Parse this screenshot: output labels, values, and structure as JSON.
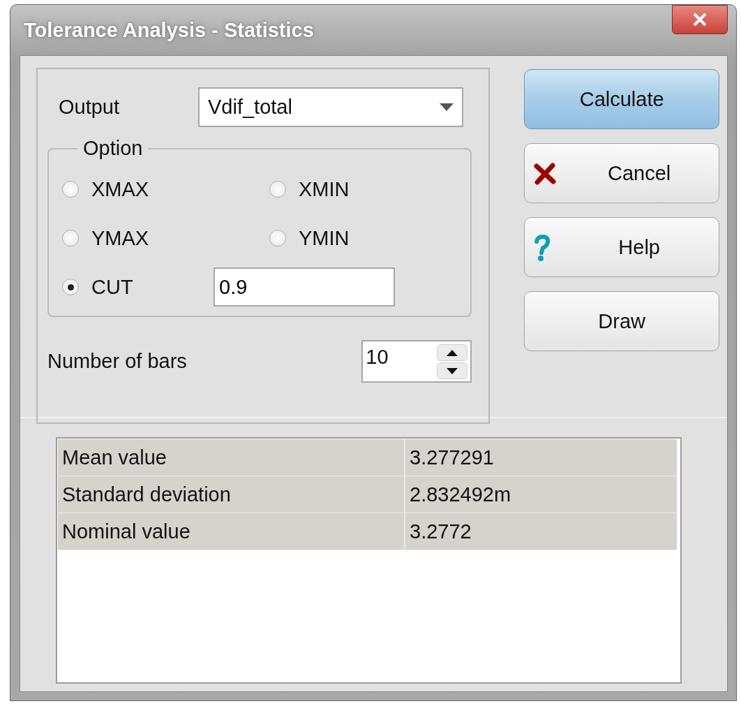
{
  "window": {
    "title": "Tolerance Analysis - Statistics"
  },
  "output": {
    "label": "Output",
    "value": "Vdif_total"
  },
  "option_group": {
    "title": "Option",
    "options": [
      {
        "label": "XMAX",
        "selected": false
      },
      {
        "label": "XMIN",
        "selected": false
      },
      {
        "label": "YMAX",
        "selected": false
      },
      {
        "label": "YMIN",
        "selected": false
      },
      {
        "label": "CUT",
        "selected": true,
        "value": "0.9"
      }
    ]
  },
  "bars": {
    "label": "Number of bars",
    "value": "10"
  },
  "buttons": [
    {
      "label": "Calculate",
      "kind": "default"
    },
    {
      "label": "Cancel",
      "kind": "cancel"
    },
    {
      "label": "Help",
      "kind": "help"
    },
    {
      "label": "Draw",
      "kind": "plain"
    }
  ],
  "results": [
    {
      "name": "Mean value",
      "value": "3.277291"
    },
    {
      "name": "Standard deviation",
      "value": "2.832492m"
    },
    {
      "name": "Nominal value",
      "value": "3.2772"
    }
  ]
}
